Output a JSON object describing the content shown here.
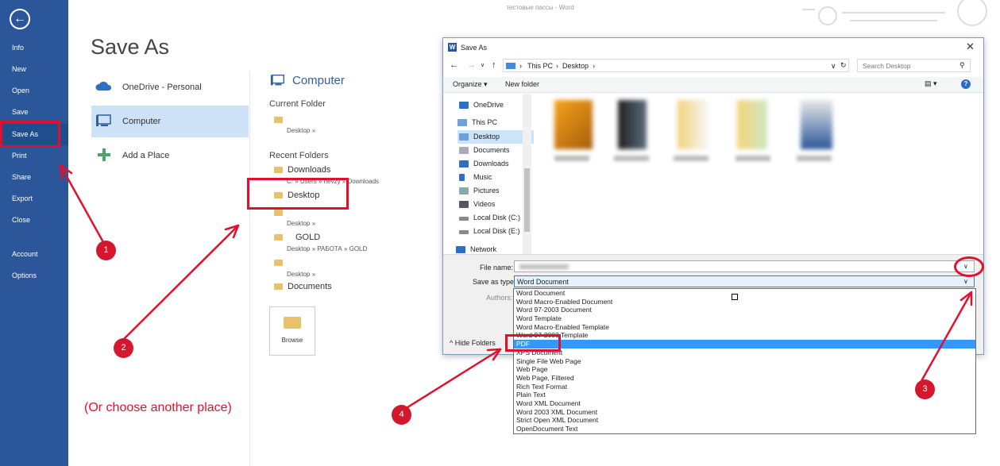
{
  "window": {
    "title": "тестовые пассы - Word"
  },
  "nav": {
    "items": [
      "Info",
      "New",
      "Open",
      "Save",
      "Save As",
      "Print",
      "Share",
      "Export",
      "Close",
      "Account",
      "Options"
    ],
    "selected": "Save As"
  },
  "backstage": {
    "title": "Save As",
    "places": [
      "OneDrive - Personal",
      "Computer",
      "Add a Place"
    ],
    "selected_place": "Computer",
    "computer_heading": "Computer",
    "current_folder_label": "Current Folder",
    "current_folder_path": "Desktop »",
    "recent_folders_label": "Recent Folders",
    "recent": [
      {
        "name": "Downloads",
        "path": "C: » Users » hevzy » Downloads"
      },
      {
        "name": "Desktop",
        "path": ""
      },
      {
        "name": "",
        "path": "Desktop »"
      },
      {
        "name": "GOLD",
        "path": "Desktop » РАБОТА » GOLD"
      },
      {
        "name": "",
        "path": "Desktop »"
      },
      {
        "name": "Documents",
        "path": ""
      }
    ],
    "browse_label": "Browse"
  },
  "dialog": {
    "title": "Save As",
    "breadcrumb": [
      "This PC",
      "Desktop"
    ],
    "search_placeholder": "Search Desktop",
    "organize_label": "Organize ▾",
    "new_folder_label": "New folder",
    "tree": [
      "OneDrive",
      "This PC",
      "Desktop",
      "Documents",
      "Downloads",
      "Music",
      "Pictures",
      "Videos",
      "Local Disk (C:)",
      "Local Disk (E:)",
      "Network"
    ],
    "tree_selected": "Desktop",
    "file_name_label": "File name:",
    "file_name_value": "",
    "save_type_label": "Save as type:",
    "save_type_value": "Word Document",
    "authors_label": "Authors:",
    "hide_folders_label": "Hide Folders",
    "type_options": [
      "Word Document",
      "Word Macro-Enabled Document",
      "Word 97-2003 Document",
      "Word Template",
      "Word Macro-Enabled Template",
      "Word 97-2003 Template",
      "PDF",
      "XPS Document",
      "Single File Web Page",
      "Web Page",
      "Web Page, Filtered",
      "Rich Text Format",
      "Plain Text",
      "Word XML Document",
      "Word 2003 XML Document",
      "Strict Open XML Document",
      "OpenDocument Text"
    ],
    "highlighted_option": "PDF"
  },
  "annotations": {
    "note": "(Or choose another place)",
    "steps": [
      "1",
      "2",
      "3",
      "4"
    ],
    "color": "#e0112e"
  },
  "colors": {
    "nav_bg": "#2b579a",
    "place_selected": "#cde2f7",
    "highlight": "#3399ff"
  }
}
